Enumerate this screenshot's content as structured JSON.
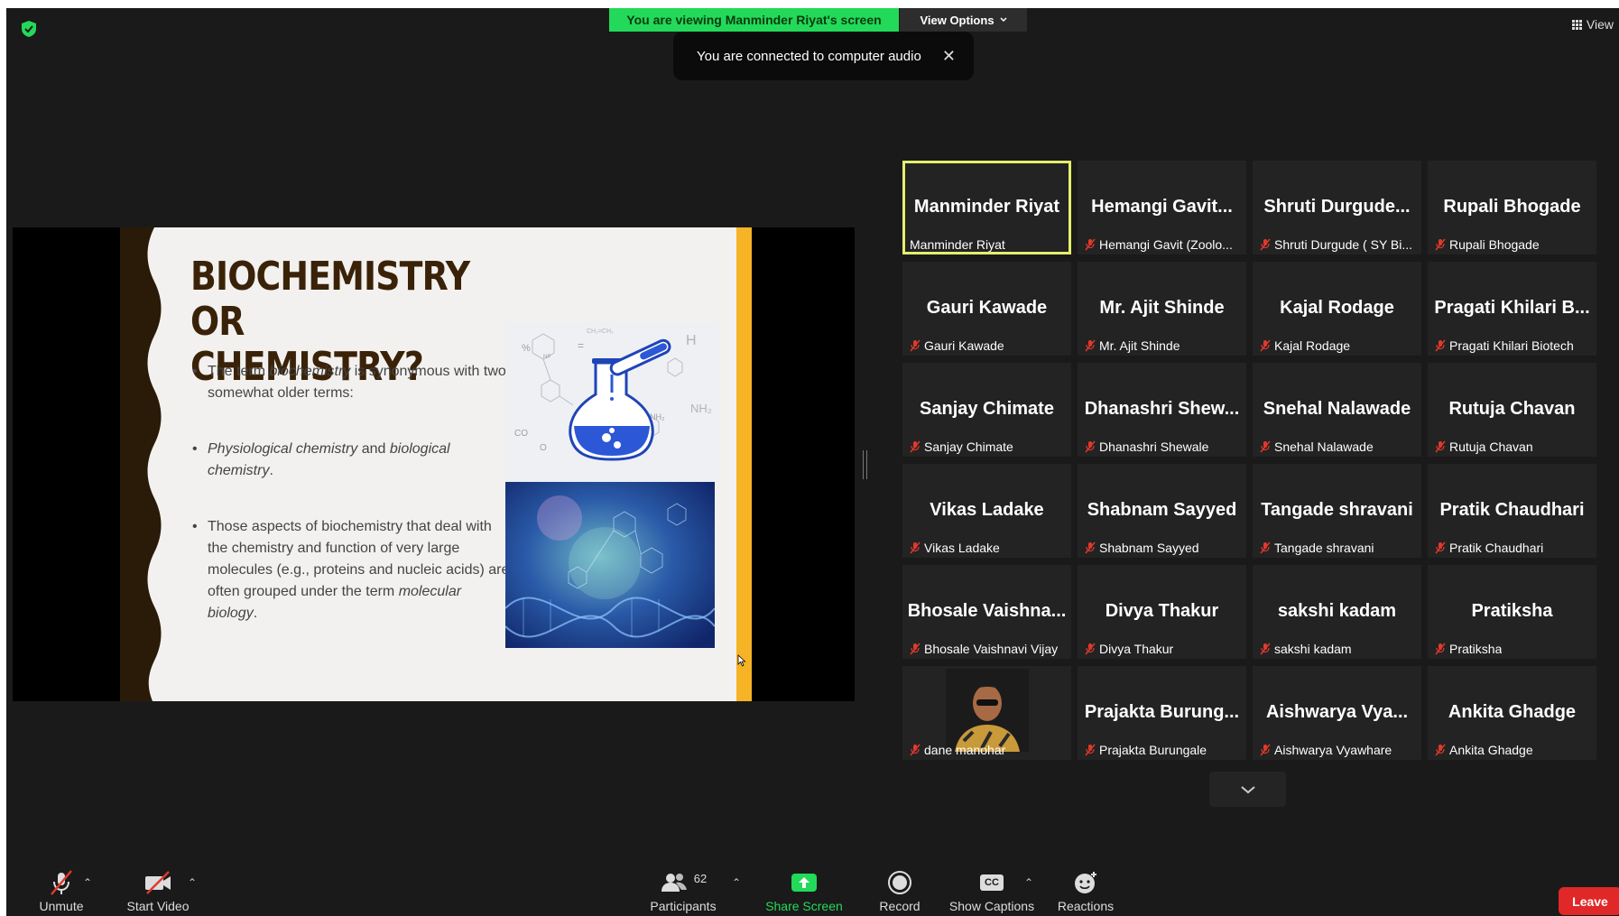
{
  "banner": {
    "viewing_text": "You are viewing Manminder Riyat's screen",
    "view_options": "View Options"
  },
  "toast": {
    "text": "You are connected to computer audio",
    "close": "✕"
  },
  "top_right": {
    "view_label": "View"
  },
  "slide": {
    "title_line1": "BIOCHEMISTRY OR",
    "title_line2": "CHEMISTRY?",
    "bullet1_a": "The term ",
    "bullet1_em": "biochemistry",
    "bullet1_b": " is synonymous with two somewhat older terms:",
    "bullet2_em1": "Physiological chemistry",
    "bullet2_mid": " and ",
    "bullet2_em2": "biological chemistry",
    "bullet2_end": ".",
    "bullet3_a": "Those aspects of biochemistry that deal with the chemistry and function of very large molecules (e.g., proteins and nucleic acids) are often grouped under the term ",
    "bullet3_em": "molecular biology",
    "bullet3_end": ".",
    "flask_labels": {
      "nh2": "NH₂",
      "co": "CO",
      "h": "H",
      "ch": "CH₂=CH₂",
      "pct": "%",
      "np": "NP",
      "o": "O",
      "eq": "="
    }
  },
  "participants": [
    {
      "big": "Manminder Riyat",
      "small": "Manminder Riyat",
      "muted": false,
      "active": true
    },
    {
      "big": "Hemangi  Gavit...",
      "small": "Hemangi Gavit (Zoolo...",
      "muted": true
    },
    {
      "big": "Shruti Durgude...",
      "small": "Shruti Durgude ( SY Bi...",
      "muted": true
    },
    {
      "big": "Rupali Bhogade",
      "small": "Rupali Bhogade",
      "muted": true
    },
    {
      "big": "Gauri Kawade",
      "small": "Gauri Kawade",
      "muted": true
    },
    {
      "big": "Mr. Ajit Shinde",
      "small": "Mr. Ajit Shinde",
      "muted": true
    },
    {
      "big": "Kajal Rodage",
      "small": "Kajal Rodage",
      "muted": true
    },
    {
      "big": "Pragati Khilari B...",
      "small": "Pragati Khilari Biotech",
      "muted": true
    },
    {
      "big": "Sanjay Chimate",
      "small": "Sanjay Chimate",
      "muted": true
    },
    {
      "big": "Dhanashri  Shew...",
      "small": "Dhanashri Shewale",
      "muted": true
    },
    {
      "big": "Snehal Nalawade",
      "small": "Snehal Nalawade",
      "muted": true
    },
    {
      "big": "Rutuja Chavan",
      "small": "Rutuja Chavan",
      "muted": true
    },
    {
      "big": "Vikas Ladake",
      "small": "Vikas Ladake",
      "muted": true
    },
    {
      "big": "Shabnam Sayyed",
      "small": "Shabnam Sayyed",
      "muted": true
    },
    {
      "big": "Tangade shravani",
      "small": "Tangade shravani",
      "muted": true
    },
    {
      "big": "Pratik Chaudhari",
      "small": "Pratik Chaudhari",
      "muted": true
    },
    {
      "big": "Bhosale  Vaishna...",
      "small": "Bhosale Vaishnavi Vijay",
      "muted": true
    },
    {
      "big": "Divya Thakur",
      "small": "Divya Thakur",
      "muted": true
    },
    {
      "big": "sakshi kadam",
      "small": "sakshi kadam",
      "muted": true
    },
    {
      "big": "Pratiksha",
      "small": "Pratiksha",
      "muted": true
    },
    {
      "big": "",
      "small": "dane manohar",
      "muted": true,
      "photo": true
    },
    {
      "big": "Prajakta  Burung...",
      "small": "Prajakta Burungale",
      "muted": true
    },
    {
      "big": "Aishwarya  Vya...",
      "small": "Aishwarya Vyawhare",
      "muted": true
    },
    {
      "big": "Ankita Ghadge",
      "small": "Ankita Ghadge",
      "muted": true
    }
  ],
  "toolbar": {
    "unmute": "Unmute",
    "start_video": "Start Video",
    "participants": "Participants",
    "participants_count": "62",
    "share_screen": "Share Screen",
    "record": "Record",
    "show_captions": "Show Captions",
    "cc": "CC",
    "reactions": "Reactions",
    "leave": "Leave",
    "caret": "⌃"
  },
  "colors": {
    "accent_green": "#23d959",
    "active_speaker": "#e4ef6b",
    "leave_red": "#e02828",
    "muted_red": "#e0392b",
    "slide_stripe": "#f5b325"
  },
  "icons": [
    "shield-icon",
    "close-icon",
    "grid-icon",
    "chevron-down-icon",
    "muted-mic-icon",
    "video-off-icon",
    "participants-icon",
    "share-up-arrow-icon",
    "record-icon",
    "cc-icon",
    "reactions-icon"
  ]
}
